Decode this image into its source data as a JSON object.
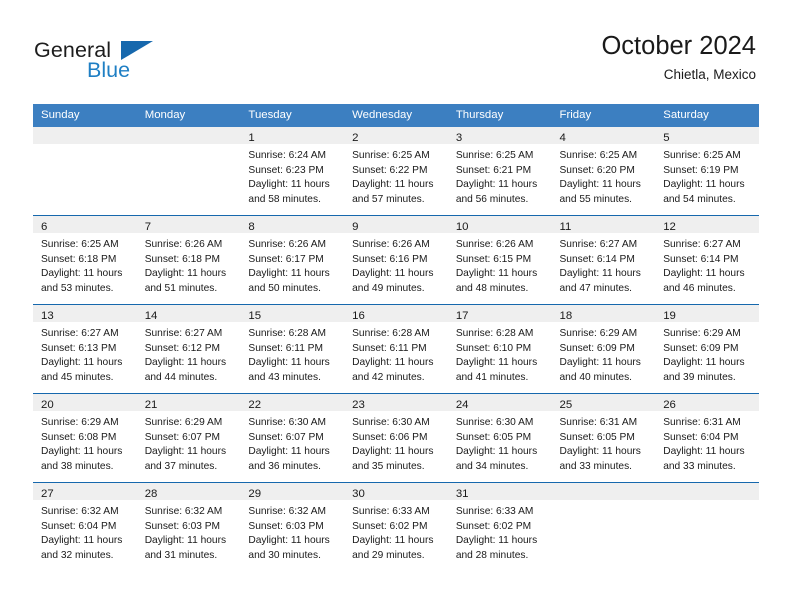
{
  "brand": {
    "name_part1": "General",
    "name_part2": "Blue",
    "triangle_color": "#1668ad"
  },
  "header": {
    "title": "October 2024",
    "subtitle": "Chietla, Mexico"
  },
  "theme": {
    "header_bar": "#3c7fc1",
    "row_divider": "#1668ad",
    "daynum_band": "#efefef",
    "brand_blue": "#1f7fc4"
  },
  "weekdays": [
    "Sunday",
    "Monday",
    "Tuesday",
    "Wednesday",
    "Thursday",
    "Friday",
    "Saturday"
  ],
  "weeks": [
    [
      {
        "day": "",
        "empty": true,
        "l1": "",
        "l2": "",
        "l3": "",
        "l4": ""
      },
      {
        "day": "",
        "empty": true,
        "l1": "",
        "l2": "",
        "l3": "",
        "l4": ""
      },
      {
        "day": "1",
        "l1": "Sunrise: 6:24 AM",
        "l2": "Sunset: 6:23 PM",
        "l3": "Daylight: 11 hours",
        "l4": "and 58 minutes."
      },
      {
        "day": "2",
        "l1": "Sunrise: 6:25 AM",
        "l2": "Sunset: 6:22 PM",
        "l3": "Daylight: 11 hours",
        "l4": "and 57 minutes."
      },
      {
        "day": "3",
        "l1": "Sunrise: 6:25 AM",
        "l2": "Sunset: 6:21 PM",
        "l3": "Daylight: 11 hours",
        "l4": "and 56 minutes."
      },
      {
        "day": "4",
        "l1": "Sunrise: 6:25 AM",
        "l2": "Sunset: 6:20 PM",
        "l3": "Daylight: 11 hours",
        "l4": "and 55 minutes."
      },
      {
        "day": "5",
        "l1": "Sunrise: 6:25 AM",
        "l2": "Sunset: 6:19 PM",
        "l3": "Daylight: 11 hours",
        "l4": "and 54 minutes."
      }
    ],
    [
      {
        "day": "6",
        "l1": "Sunrise: 6:25 AM",
        "l2": "Sunset: 6:18 PM",
        "l3": "Daylight: 11 hours",
        "l4": "and 53 minutes."
      },
      {
        "day": "7",
        "l1": "Sunrise: 6:26 AM",
        "l2": "Sunset: 6:18 PM",
        "l3": "Daylight: 11 hours",
        "l4": "and 51 minutes."
      },
      {
        "day": "8",
        "l1": "Sunrise: 6:26 AM",
        "l2": "Sunset: 6:17 PM",
        "l3": "Daylight: 11 hours",
        "l4": "and 50 minutes."
      },
      {
        "day": "9",
        "l1": "Sunrise: 6:26 AM",
        "l2": "Sunset: 6:16 PM",
        "l3": "Daylight: 11 hours",
        "l4": "and 49 minutes."
      },
      {
        "day": "10",
        "l1": "Sunrise: 6:26 AM",
        "l2": "Sunset: 6:15 PM",
        "l3": "Daylight: 11 hours",
        "l4": "and 48 minutes."
      },
      {
        "day": "11",
        "l1": "Sunrise: 6:27 AM",
        "l2": "Sunset: 6:14 PM",
        "l3": "Daylight: 11 hours",
        "l4": "and 47 minutes."
      },
      {
        "day": "12",
        "l1": "Sunrise: 6:27 AM",
        "l2": "Sunset: 6:14 PM",
        "l3": "Daylight: 11 hours",
        "l4": "and 46 minutes."
      }
    ],
    [
      {
        "day": "13",
        "l1": "Sunrise: 6:27 AM",
        "l2": "Sunset: 6:13 PM",
        "l3": "Daylight: 11 hours",
        "l4": "and 45 minutes."
      },
      {
        "day": "14",
        "l1": "Sunrise: 6:27 AM",
        "l2": "Sunset: 6:12 PM",
        "l3": "Daylight: 11 hours",
        "l4": "and 44 minutes."
      },
      {
        "day": "15",
        "l1": "Sunrise: 6:28 AM",
        "l2": "Sunset: 6:11 PM",
        "l3": "Daylight: 11 hours",
        "l4": "and 43 minutes."
      },
      {
        "day": "16",
        "l1": "Sunrise: 6:28 AM",
        "l2": "Sunset: 6:11 PM",
        "l3": "Daylight: 11 hours",
        "l4": "and 42 minutes."
      },
      {
        "day": "17",
        "l1": "Sunrise: 6:28 AM",
        "l2": "Sunset: 6:10 PM",
        "l3": "Daylight: 11 hours",
        "l4": "and 41 minutes."
      },
      {
        "day": "18",
        "l1": "Sunrise: 6:29 AM",
        "l2": "Sunset: 6:09 PM",
        "l3": "Daylight: 11 hours",
        "l4": "and 40 minutes."
      },
      {
        "day": "19",
        "l1": "Sunrise: 6:29 AM",
        "l2": "Sunset: 6:09 PM",
        "l3": "Daylight: 11 hours",
        "l4": "and 39 minutes."
      }
    ],
    [
      {
        "day": "20",
        "l1": "Sunrise: 6:29 AM",
        "l2": "Sunset: 6:08 PM",
        "l3": "Daylight: 11 hours",
        "l4": "and 38 minutes."
      },
      {
        "day": "21",
        "l1": "Sunrise: 6:29 AM",
        "l2": "Sunset: 6:07 PM",
        "l3": "Daylight: 11 hours",
        "l4": "and 37 minutes."
      },
      {
        "day": "22",
        "l1": "Sunrise: 6:30 AM",
        "l2": "Sunset: 6:07 PM",
        "l3": "Daylight: 11 hours",
        "l4": "and 36 minutes."
      },
      {
        "day": "23",
        "l1": "Sunrise: 6:30 AM",
        "l2": "Sunset: 6:06 PM",
        "l3": "Daylight: 11 hours",
        "l4": "and 35 minutes."
      },
      {
        "day": "24",
        "l1": "Sunrise: 6:30 AM",
        "l2": "Sunset: 6:05 PM",
        "l3": "Daylight: 11 hours",
        "l4": "and 34 minutes."
      },
      {
        "day": "25",
        "l1": "Sunrise: 6:31 AM",
        "l2": "Sunset: 6:05 PM",
        "l3": "Daylight: 11 hours",
        "l4": "and 33 minutes."
      },
      {
        "day": "26",
        "l1": "Sunrise: 6:31 AM",
        "l2": "Sunset: 6:04 PM",
        "l3": "Daylight: 11 hours",
        "l4": "and 33 minutes."
      }
    ],
    [
      {
        "day": "27",
        "l1": "Sunrise: 6:32 AM",
        "l2": "Sunset: 6:04 PM",
        "l3": "Daylight: 11 hours",
        "l4": "and 32 minutes."
      },
      {
        "day": "28",
        "l1": "Sunrise: 6:32 AM",
        "l2": "Sunset: 6:03 PM",
        "l3": "Daylight: 11 hours",
        "l4": "and 31 minutes."
      },
      {
        "day": "29",
        "l1": "Sunrise: 6:32 AM",
        "l2": "Sunset: 6:03 PM",
        "l3": "Daylight: 11 hours",
        "l4": "and 30 minutes."
      },
      {
        "day": "30",
        "l1": "Sunrise: 6:33 AM",
        "l2": "Sunset: 6:02 PM",
        "l3": "Daylight: 11 hours",
        "l4": "and 29 minutes."
      },
      {
        "day": "31",
        "l1": "Sunrise: 6:33 AM",
        "l2": "Sunset: 6:02 PM",
        "l3": "Daylight: 11 hours",
        "l4": "and 28 minutes."
      },
      {
        "day": "",
        "empty": true,
        "l1": "",
        "l2": "",
        "l3": "",
        "l4": ""
      },
      {
        "day": "",
        "empty": true,
        "l1": "",
        "l2": "",
        "l3": "",
        "l4": ""
      }
    ]
  ]
}
